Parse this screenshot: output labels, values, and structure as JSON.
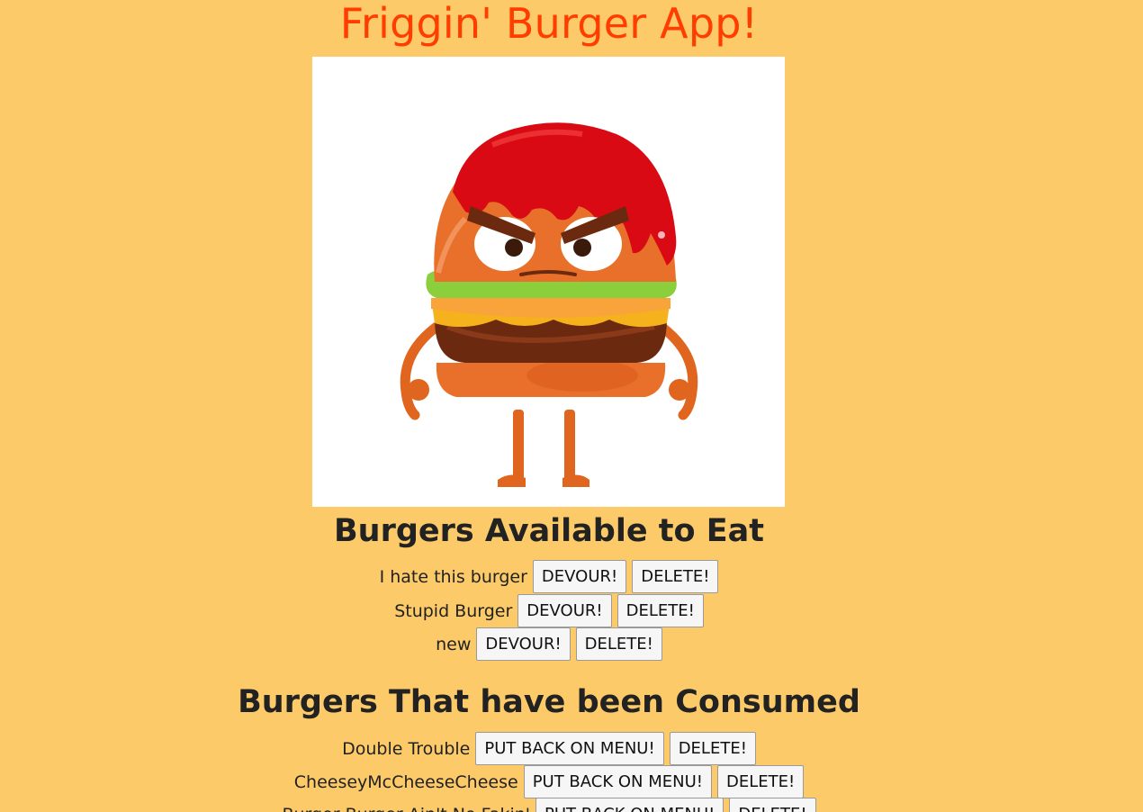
{
  "app": {
    "title": "Friggin' Burger App!",
    "hero_image": "angry-burger-mascot"
  },
  "available": {
    "heading": "Burgers Available to Eat",
    "items": [
      {
        "name": "I hate this burger",
        "primary_action": "DEVOUR!",
        "delete_action": "DELETE!"
      },
      {
        "name": "Stupid Burger",
        "primary_action": "DEVOUR!",
        "delete_action": "DELETE!"
      },
      {
        "name": "new",
        "primary_action": "DEVOUR!",
        "delete_action": "DELETE!"
      }
    ]
  },
  "consumed": {
    "heading": "Burgers That have been Consumed",
    "items": [
      {
        "name": "Double Trouble",
        "primary_action": "PUT BACK ON MENU!",
        "delete_action": "DELETE!"
      },
      {
        "name": "CheeseyMcCheeseCheese",
        "primary_action": "PUT BACK ON MENU!",
        "delete_action": "DELETE!"
      },
      {
        "name": "Burger Burger Ain't No Fakin'",
        "primary_action": "PUT BACK ON MENU!",
        "delete_action": "DELETE!"
      }
    ]
  },
  "colors": {
    "background": "#fcca68",
    "title": "#ff3d00",
    "ketchup": "#d90a14",
    "bun": "#e8702a",
    "patty": "#6b2a10",
    "lettuce": "#8ccf3c",
    "cheese": "#f6b21c"
  }
}
